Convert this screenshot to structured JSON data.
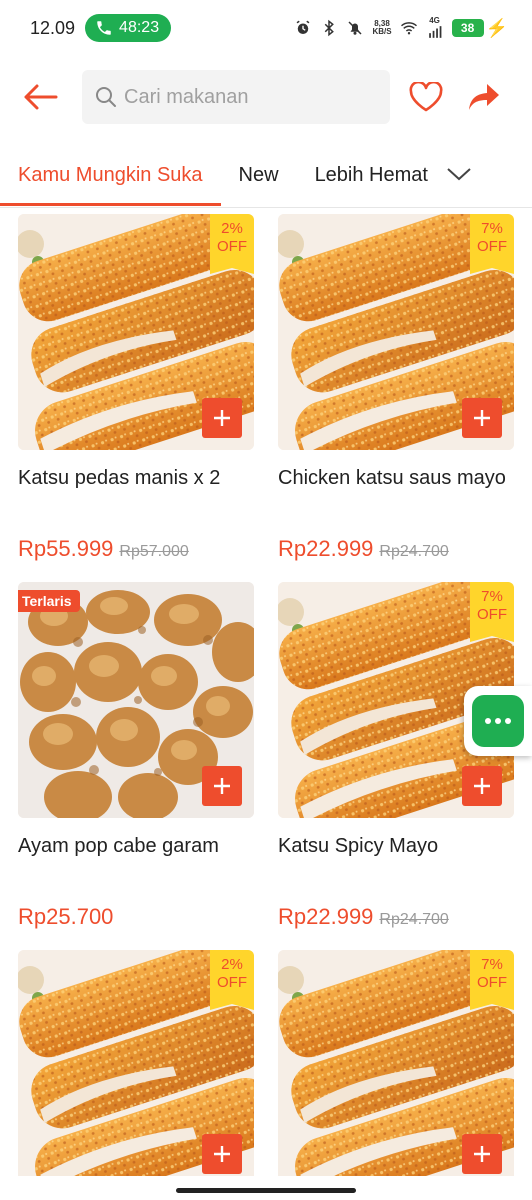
{
  "status_bar": {
    "time": "12.09",
    "call_duration": "48:23",
    "net_speed_value": "8,38",
    "net_speed_unit": "KB/S",
    "network_type": "4G",
    "battery": "38"
  },
  "header": {
    "search_placeholder": "Cari makanan"
  },
  "tabs": [
    {
      "label": "Kamu Mungkin Suka",
      "active": true
    },
    {
      "label": "New",
      "active": false
    },
    {
      "label": "Lebih Hemat",
      "active": false
    }
  ],
  "colors": {
    "accent": "#ee4d2d",
    "discount_badge": "#ffd52b",
    "chat_green": "#1fae52"
  },
  "products": [
    {
      "name": "Katsu pedas manis x 2",
      "price": "Rp55.999",
      "old_price": "Rp57.000",
      "discount_pct": "2%",
      "discount_word": "OFF",
      "badge": "",
      "image": "chicken-katsu"
    },
    {
      "name": "Chicken katsu saus mayo",
      "price": "Rp22.999",
      "old_price": "Rp24.700",
      "discount_pct": "7%",
      "discount_word": "OFF",
      "badge": "",
      "image": "chicken-katsu"
    },
    {
      "name": "Ayam pop cabe garam",
      "price": "Rp25.700",
      "old_price": "",
      "discount_pct": "",
      "discount_word": "",
      "badge": "Terlaris",
      "image": "popcorn-chicken"
    },
    {
      "name": "Katsu Spicy Mayo",
      "price": "Rp22.999",
      "old_price": "Rp24.700",
      "discount_pct": "7%",
      "discount_word": "OFF",
      "badge": "",
      "image": "chicken-katsu"
    },
    {
      "name": "",
      "price": "",
      "old_price": "",
      "discount_pct": "2%",
      "discount_word": "OFF",
      "badge": "",
      "image": "chicken-katsu"
    },
    {
      "name": "",
      "price": "",
      "old_price": "",
      "discount_pct": "7%",
      "discount_word": "OFF",
      "badge": "",
      "image": "chicken-katsu"
    }
  ],
  "icons": {
    "back": "arrow-left-icon",
    "search": "search-icon",
    "favorite": "heart-icon",
    "share": "share-icon",
    "tabs_more": "chevron-down-icon",
    "add": "plus-icon",
    "chat": "more-dots-icon"
  }
}
